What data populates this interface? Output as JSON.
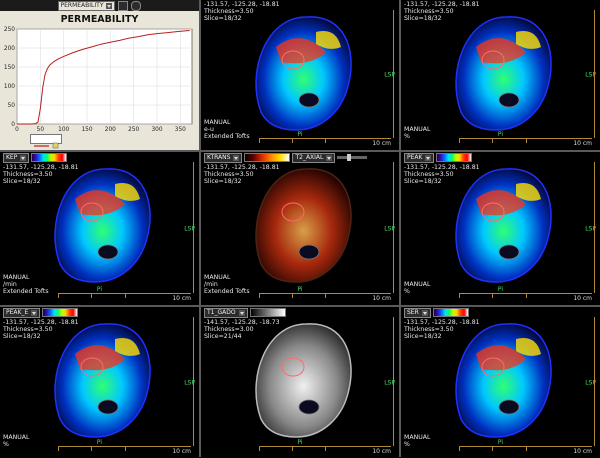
{
  "graph": {
    "dropdown": "PERMEABILITY",
    "title": "PERMEABILITY",
    "chart_data": {
      "type": "line",
      "title": "PERMEABILITY",
      "xlabel": "",
      "ylabel": "",
      "xlim": [
        0,
        375
      ],
      "ylim": [
        0,
        250
      ],
      "xticks": [
        0,
        50,
        100,
        150,
        200,
        250,
        300,
        350
      ],
      "yticks": [
        0,
        50,
        100,
        150,
        200,
        250
      ],
      "series": [
        {
          "color": "#b52020",
          "x": [
            0,
            10,
            20,
            30,
            40,
            45,
            50,
            55,
            60,
            65,
            70,
            80,
            90,
            100,
            120,
            140,
            160,
            180,
            200,
            220,
            240,
            260,
            280,
            300,
            320,
            340,
            360,
            370
          ],
          "y": [
            0,
            0,
            0,
            0,
            1,
            5,
            40,
            95,
            130,
            145,
            155,
            165,
            172,
            178,
            188,
            196,
            203,
            210,
            215,
            220,
            226,
            230,
            235,
            238,
            240,
            243,
            245,
            246
          ]
        }
      ],
      "legend": "bottom-left"
    }
  },
  "viewports": [
    {
      "id": "vp2",
      "map": "",
      "info": "-131.57, -125.28, -18.81\nThickness=3.50\nSlice=18/32",
      "foot": "MANUAL\ne-u\nExtended Tofts",
      "scale_label": "10 cm",
      "orient": "LSP",
      "pos": "Pi",
      "palette": "rainbow"
    },
    {
      "id": "vp3",
      "map": "",
      "info": "-131.57, -125.28, -18.81\nThickness=3.50\nSlice=18/32",
      "foot": "MANUAL\n%",
      "scale_label": "10 cm",
      "orient": "LSP",
      "pos": "Pi",
      "palette": "rainbow"
    },
    {
      "id": "vp4",
      "map": "KEP",
      "info": "-131.57, -125.28, -18.81\nThickness=3.50\nSlice=18/32",
      "foot": "MANUAL\n/min\nExtended Tofts",
      "scale_label": "10 cm",
      "orient": "LSP",
      "pos": "Pi",
      "palette": "rainbow"
    },
    {
      "id": "vp5",
      "map": "KTRANS",
      "map2": "T2_AXIAL",
      "info": "-131.57, -125.28, -18.81\nThickness=3.50\nSlice=18/32",
      "foot": "MANUAL\n/min\nExtended Tofts",
      "scale_label": "10 cm",
      "orient": "LSP",
      "pos": "Pi",
      "palette": "hot"
    },
    {
      "id": "vp6",
      "map": "PEAK",
      "info": "-131.57, -125.28, -18.81\nThickness=3.50\nSlice=18/32",
      "foot": "MANUAL\n%",
      "scale_label": "10 cm",
      "orient": "LSP",
      "pos": "Pi",
      "palette": "rainbow"
    },
    {
      "id": "vp7",
      "map": "PEAK_E",
      "info": "-131.57, -125.28, -18.81\nThickness=3.50\nSlice=18/32",
      "foot": "MANUAL\n%",
      "scale_label": "10 cm",
      "orient": "LSP",
      "pos": "Pi",
      "palette": "rainbow"
    },
    {
      "id": "vp8",
      "map": "T1_GADO",
      "info": "-141.57, -125.28, -18.73\nThickness=3.00\nSlice=21/44",
      "foot": "",
      "scale_label": "10 cm",
      "orient": "LSP",
      "pos": "Pi",
      "palette": "gray"
    },
    {
      "id": "vp9",
      "map": "SER",
      "info": "-131.57, -125.28, -18.81\nThickness=3.50\nSlice=18/32",
      "foot": "MANUAL\n%",
      "scale_label": "10 cm",
      "orient": "LSP",
      "pos": "Pi",
      "palette": "rainbow"
    }
  ]
}
